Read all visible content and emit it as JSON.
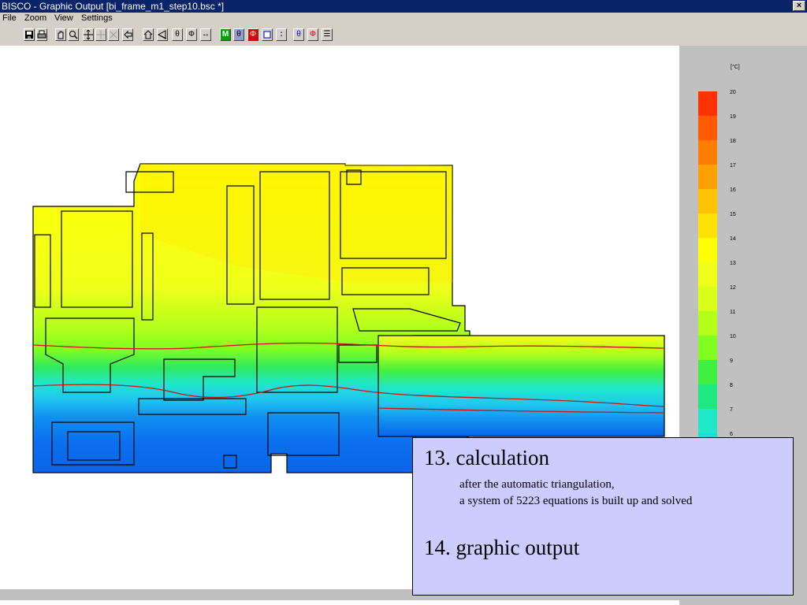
{
  "window": {
    "title": "BISCO - Graphic Output [bi_frame_m1_step10.bsc *]",
    "close_glyph": "×"
  },
  "menu": [
    "File",
    "Zoom",
    "View",
    "Settings"
  ],
  "toolbar": [
    {
      "icon": "save-icon"
    },
    {
      "icon": "print-icon"
    },
    {
      "icon": "hand-icon"
    },
    {
      "icon": "zoom-icon"
    },
    {
      "icon": "move-icon"
    },
    {
      "icon": "move-gray-icon"
    },
    {
      "icon": "cross-gray-icon"
    },
    {
      "icon": "back-icon"
    },
    {
      "icon": "home-icon"
    },
    {
      "icon": "triangle-icon"
    },
    {
      "icon": "theta-icon",
      "label": "θ"
    },
    {
      "icon": "phi-icon",
      "label": "Φ"
    },
    {
      "icon": "arrow-lr-icon",
      "label": "↔"
    },
    {
      "icon": "m-icon",
      "label": "M"
    },
    {
      "icon": "theta-box-icon",
      "label": "θ"
    },
    {
      "icon": "phi-red-icon",
      "label": "Φ"
    },
    {
      "icon": "square-icon"
    },
    {
      "icon": "colon-icon",
      "label": ":"
    },
    {
      "icon": "theta-lines-icon",
      "label": "θ"
    },
    {
      "icon": "phi-lines-icon",
      "label": "Φ"
    },
    {
      "icon": "lines-icon",
      "label": "☰"
    }
  ],
  "legend": {
    "unit": "[°C]",
    "steps": [
      {
        "label": "20",
        "color": "#ff3300"
      },
      {
        "label": "19",
        "color": "#ff5a00"
      },
      {
        "label": "18",
        "color": "#ff7e00"
      },
      {
        "label": "17",
        "color": "#ffa100"
      },
      {
        "label": "16",
        "color": "#ffc300"
      },
      {
        "label": "15",
        "color": "#ffe200"
      },
      {
        "label": "14",
        "color": "#ffff00"
      },
      {
        "label": "13",
        "color": "#f0ff1a"
      },
      {
        "label": "12",
        "color": "#d9ff1a"
      },
      {
        "label": "11",
        "color": "#b3ff1a"
      },
      {
        "label": "10",
        "color": "#80ff20"
      },
      {
        "label": "9",
        "color": "#40f040"
      },
      {
        "label": "8",
        "color": "#20e880"
      },
      {
        "label": "7",
        "color": "#20e8c8"
      },
      {
        "label": "6",
        "color": "#20d8e8"
      }
    ]
  },
  "slide": {
    "heading1": "13. calculation",
    "line1": "after the automatic triangulation,",
    "line2": "a system of 5223 equations is built up and solved",
    "heading2": "14. graphic output"
  }
}
